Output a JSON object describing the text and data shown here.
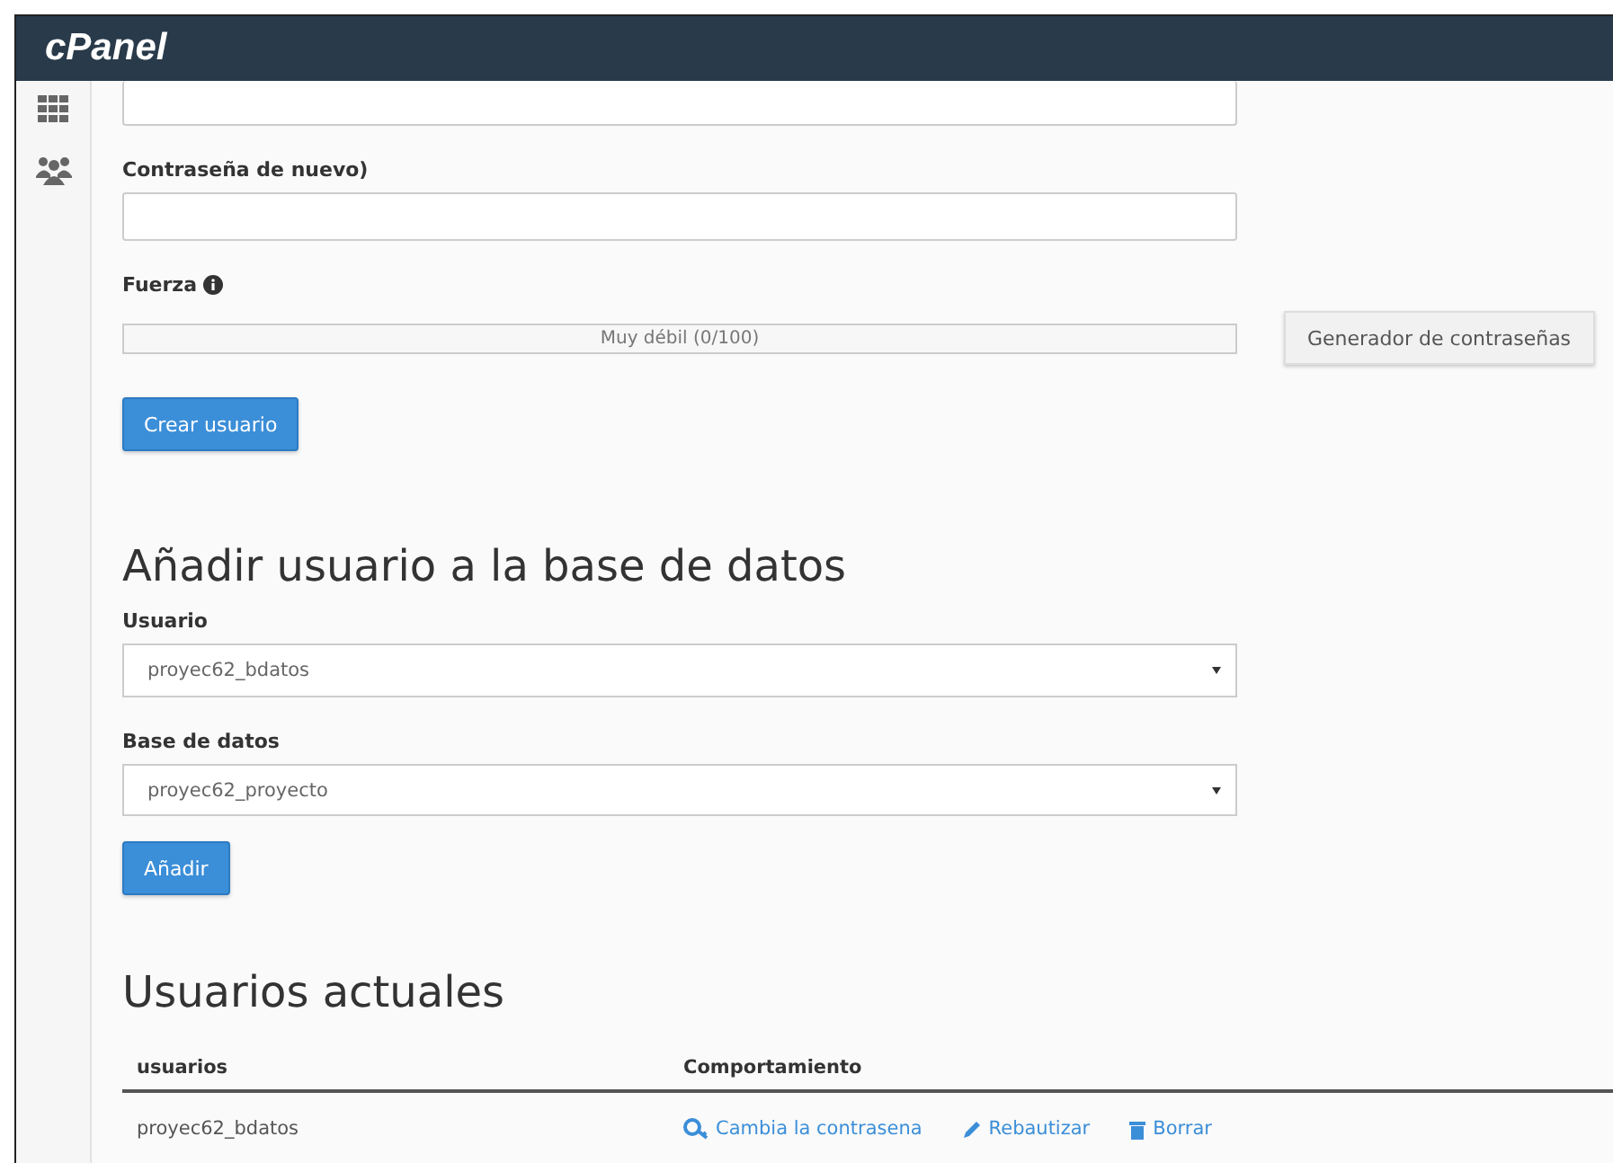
{
  "header": {
    "logo": "cPanel"
  },
  "form": {
    "confirm_label": "Contraseña de nuevo)",
    "strength_label": "Fuerza",
    "strength": {
      "reading": "Muy débil (0/100)",
      "level": 0
    },
    "generator_button": "Generador de contraseñas",
    "create_button": "Crear usuario"
  },
  "add_section": {
    "title": "Añadir usuario a la base de datos",
    "user_label": "Usuario",
    "user_value": "proyec62_bdatos",
    "db_label": "Base de datos",
    "db_value": "proyec62_proyecto",
    "add_button": "Añadir"
  },
  "users_section": {
    "title": "Usuarios actuales",
    "columns": [
      "usuarios",
      "Comportamiento"
    ],
    "rows": [
      {
        "user": "proyec62_bdatos",
        "actions": [
          {
            "kind": "password",
            "label": "Cambia la contrasena"
          },
          {
            "kind": "rename",
            "label": "Rebautizar"
          },
          {
            "kind": "delete",
            "label": "Borrar"
          }
        ]
      }
    ]
  }
}
